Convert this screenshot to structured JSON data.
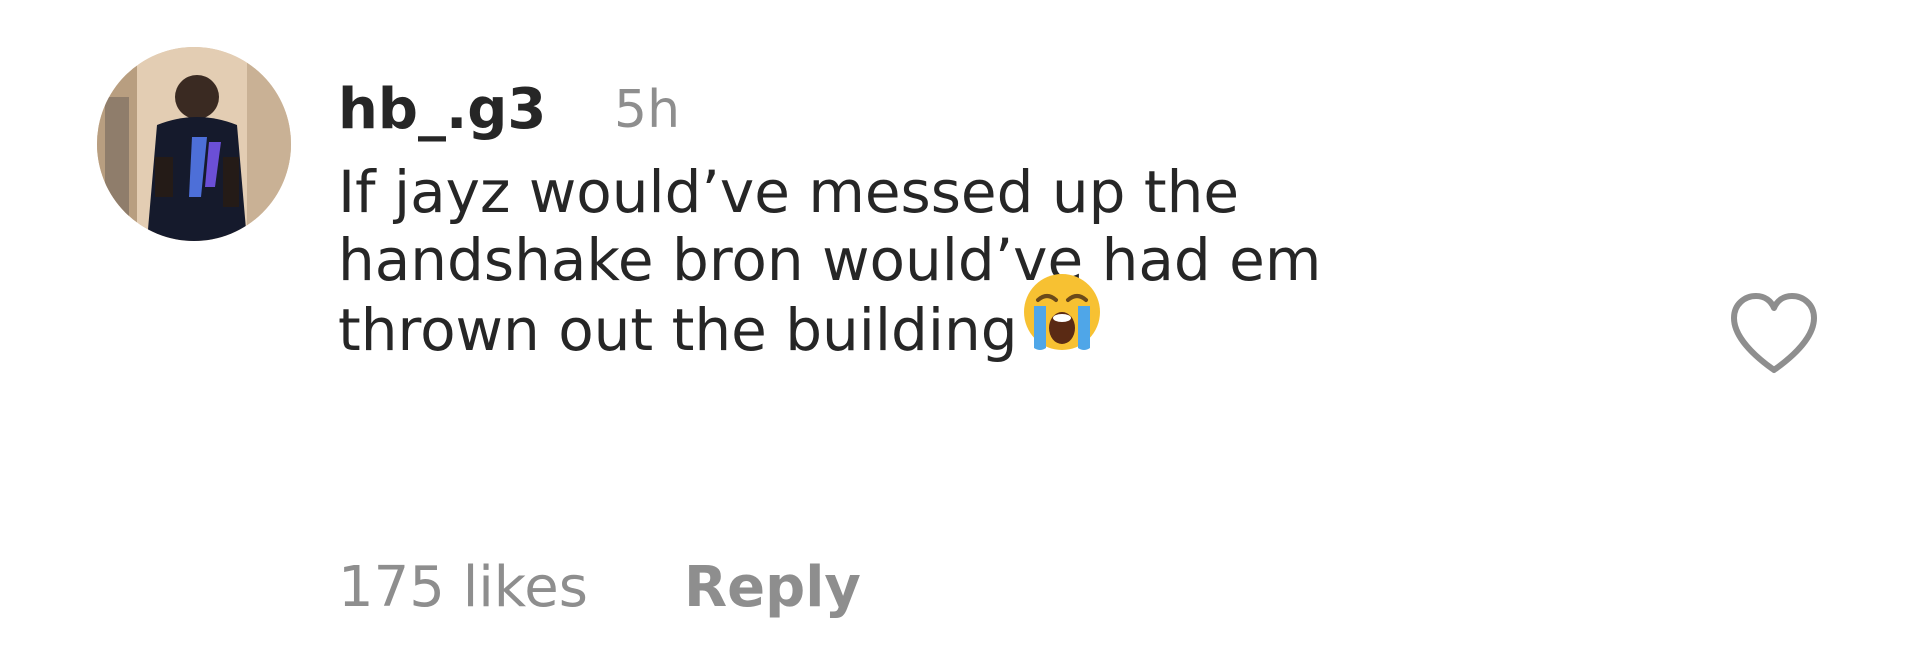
{
  "comment": {
    "username": "hb_.g3",
    "timestamp": "5h",
    "text_lines": [
      "If jayz would’ve messed up the",
      "handshake bron would’ve had em",
      "thrown out the building"
    ],
    "emoji": "loudly-crying-face",
    "likes": "175 likes",
    "reply_label": "Reply"
  },
  "icons": {
    "like": "heart-outline-icon"
  },
  "colors": {
    "primary_text": "#262626",
    "secondary_text": "#8e8e8e",
    "background": "#ffffff"
  }
}
